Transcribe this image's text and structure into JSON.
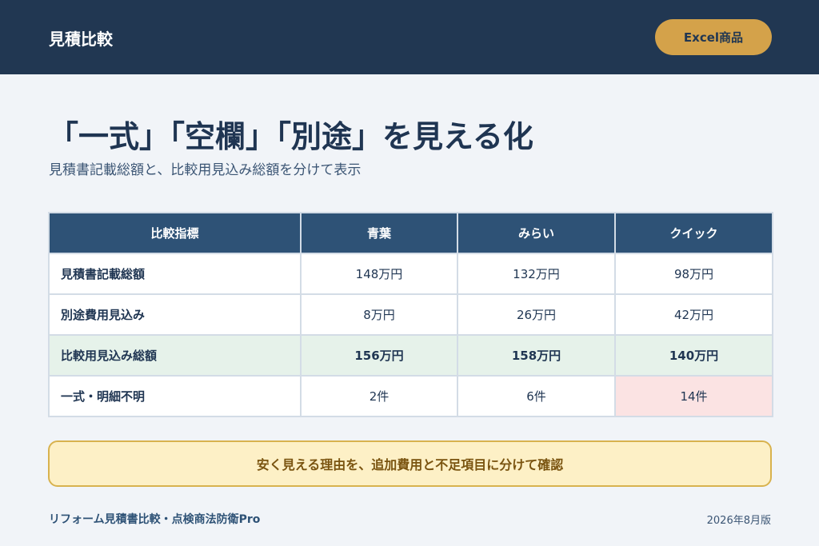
{
  "header": {
    "title": "見積比較",
    "excel_button": "Excel商品"
  },
  "headline": "「一式」「空欄」「別途」を見える化",
  "subline": "見積書記載総額と、比較用見込み総額を分けて表示",
  "table": {
    "columns": [
      "比較指標",
      "青葉",
      "みらい",
      "クイック"
    ],
    "rows": [
      {
        "label": "見積書記載総額",
        "values": [
          "148万円",
          "132万円",
          "98万円"
        ]
      },
      {
        "label": "別途費用見込み",
        "values": [
          "8万円",
          "26万円",
          "42万円"
        ]
      },
      {
        "label": "比較用見込み総額",
        "values": [
          "156万円",
          "158万円",
          "140万円"
        ]
      },
      {
        "label": "一式・明細不明",
        "values": [
          "2件",
          "6件",
          "14件"
        ]
      }
    ]
  },
  "banner": "安く見える理由を、追加費用と不足項目に分けて確認",
  "footer": {
    "left": "リフォーム見積書比較・点検商法防衛Pro",
    "right": "2026年8月版"
  },
  "colors": {
    "header_bg": "#213752",
    "accent_gold": "#d4a24a",
    "table_header": "#2e5276",
    "highlight_row": "#e6f2ea",
    "warning_cell": "#fbe3e3",
    "banner_bg": "#fdf0c6"
  }
}
